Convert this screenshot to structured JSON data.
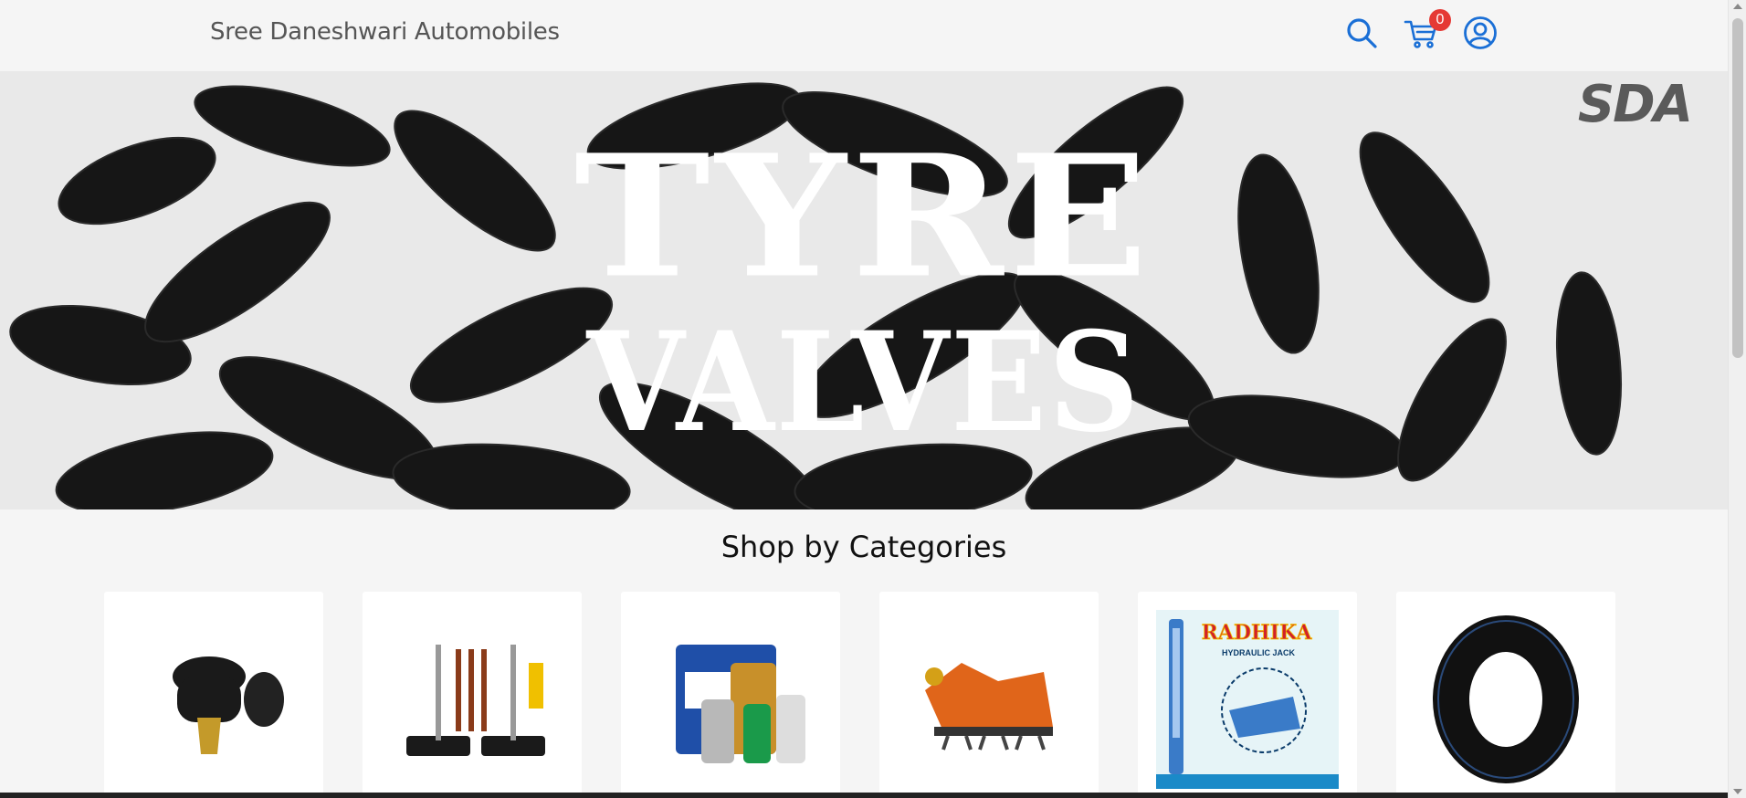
{
  "header": {
    "brand": "Sree Daneshwari Automobiles",
    "cart_count": "0",
    "icons": [
      "search-icon",
      "cart-icon",
      "account-icon"
    ]
  },
  "hero": {
    "line1": "TYRE",
    "line2": "VALVES",
    "logo": "SDA"
  },
  "categories": {
    "title": "Shop by Categories",
    "items": [
      {
        "image": "tyre-valve-image"
      },
      {
        "image": "puncture-repair-kit-image"
      },
      {
        "image": "engine-oil-image"
      },
      {
        "image": "rotavator-image"
      },
      {
        "image": "hydraulic-jack-image",
        "brand_text": "RADHIKA",
        "caption": "HYDRAULIC JACK"
      },
      {
        "image": "inner-tube-image"
      }
    ]
  },
  "colors": {
    "accent": "#1a6fd6",
    "badge": "#e53935",
    "background": "#f5f5f5"
  }
}
